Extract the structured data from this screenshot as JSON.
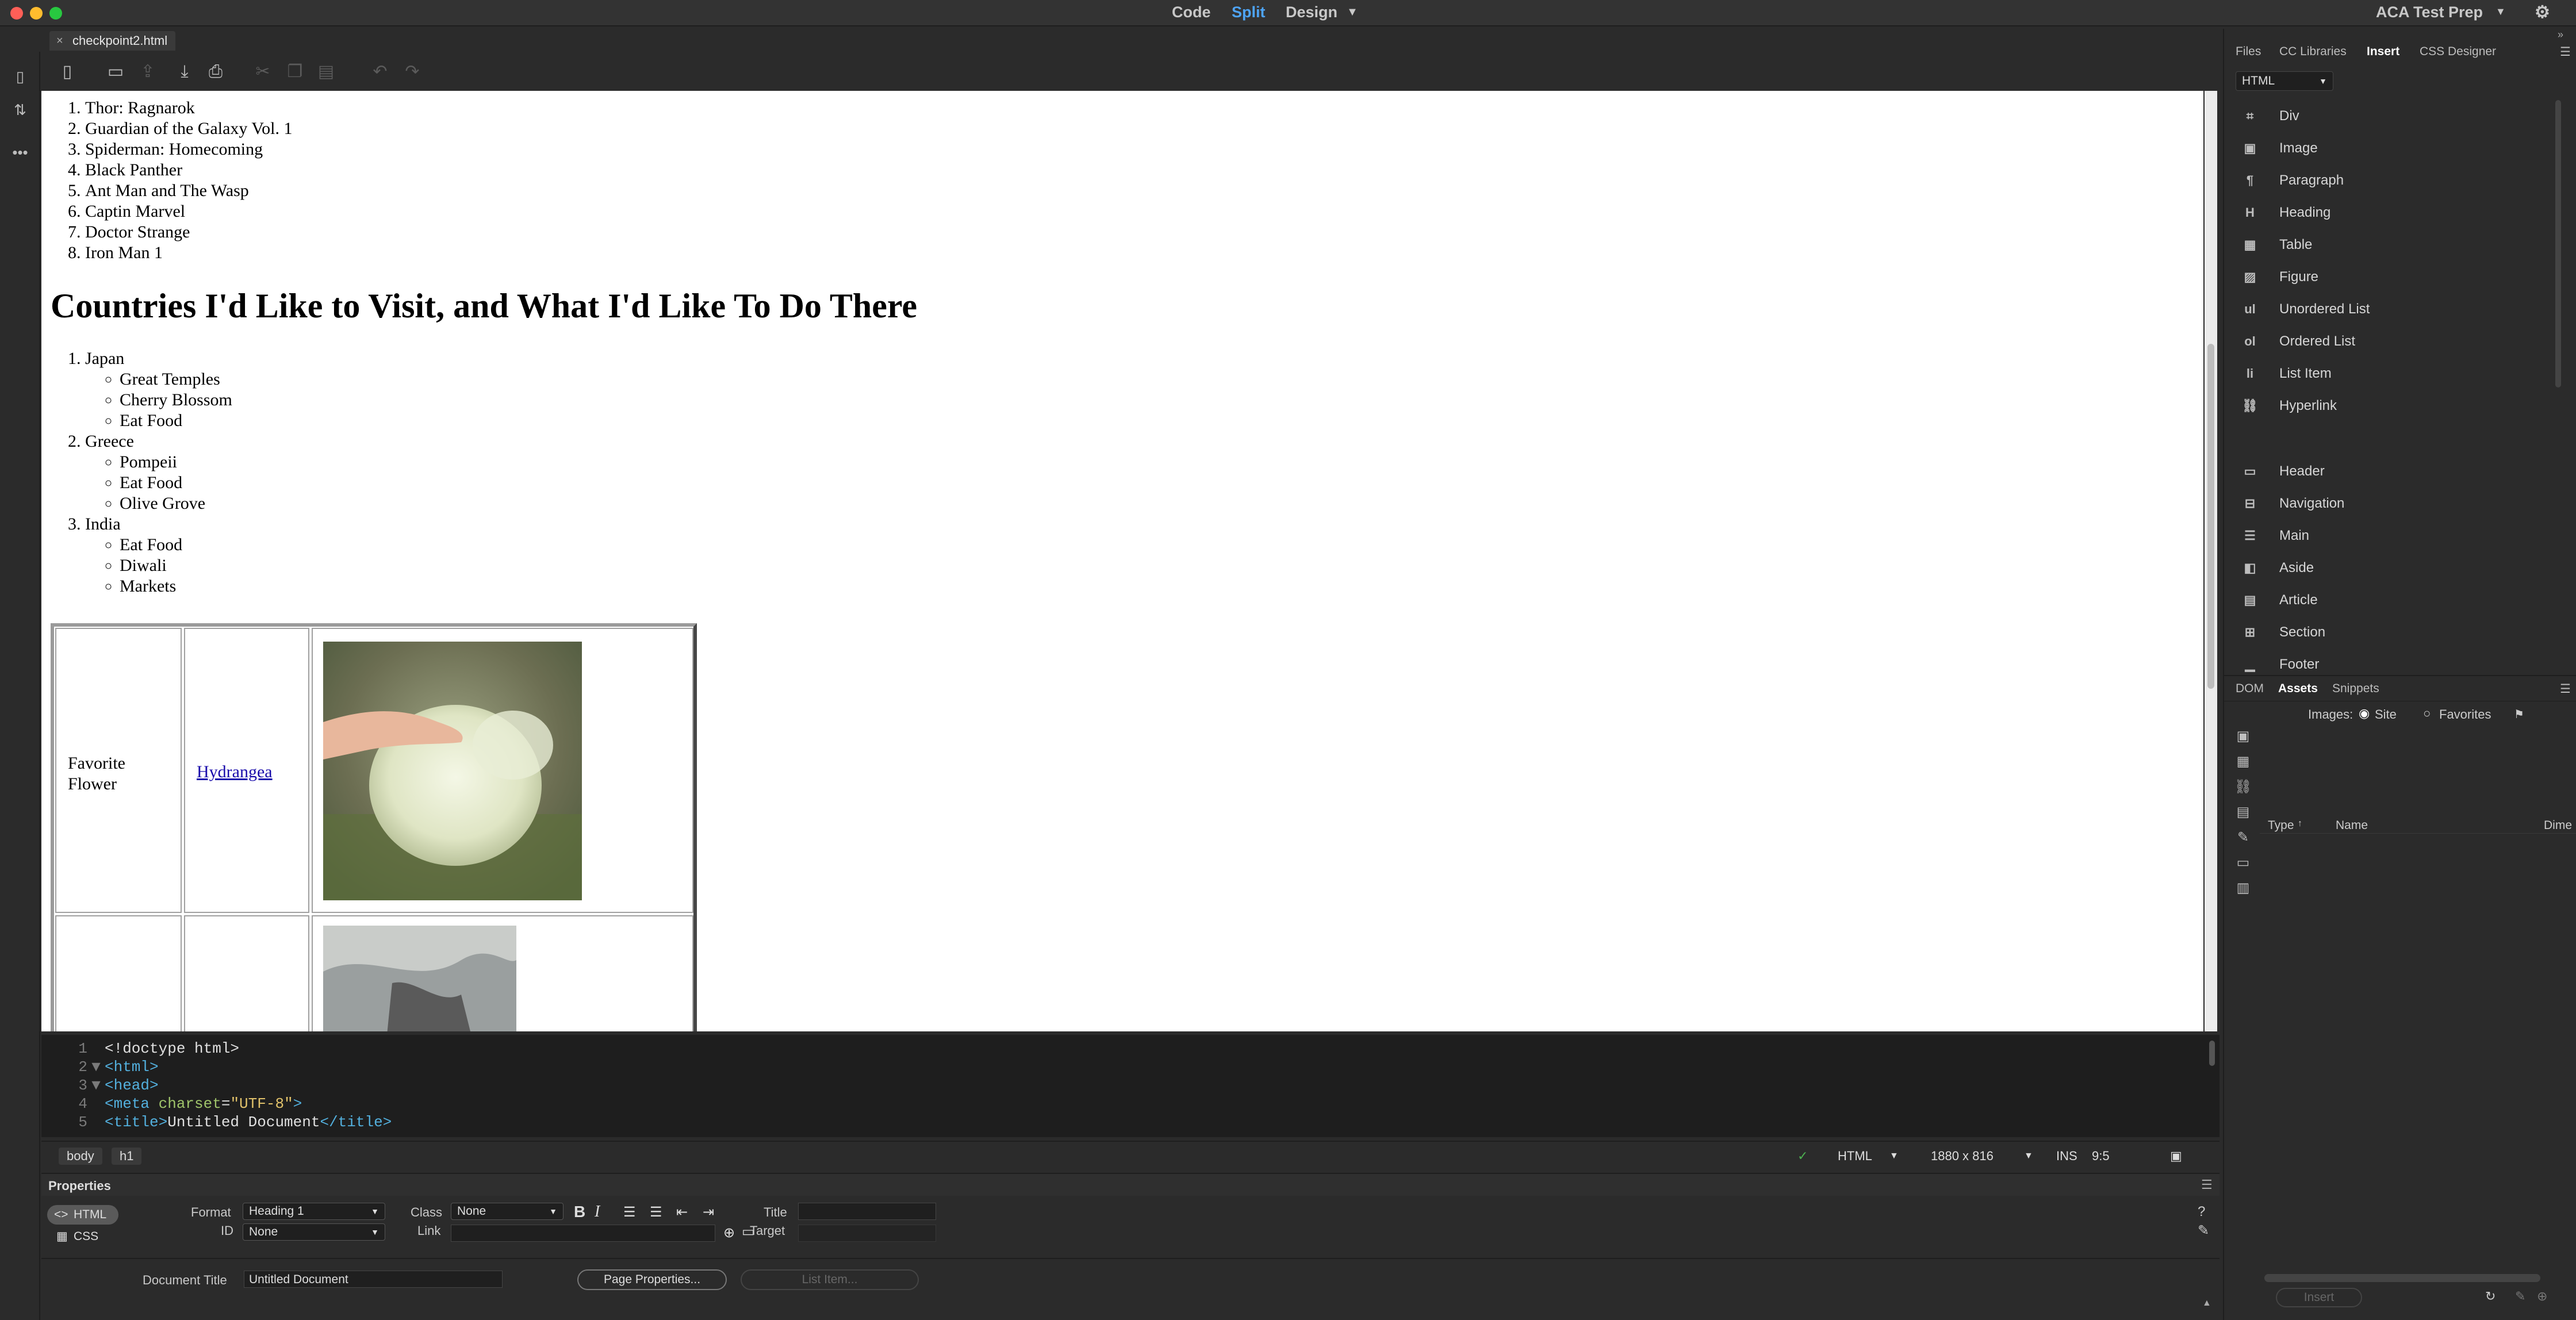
{
  "titlebar": {
    "modes": [
      "Code",
      "Split",
      "Design"
    ],
    "active_mode": "Split",
    "workspace": "ACA Test Prep"
  },
  "document": {
    "tab_label": "checkpoint2.html",
    "close_glyph": "×"
  },
  "design": {
    "movies": [
      "Thor: Ragnarok",
      "Guardian of the Galaxy Vol. 1",
      "Spiderman: Homecoming",
      "Black Panther",
      "Ant Man and The Wasp",
      "Captin Marvel",
      "Doctor Strange",
      "Iron Man 1"
    ],
    "heading": "Countries I'd Like to Visit, and What I'd Like To Do There",
    "countries": [
      {
        "name": "Japan",
        "items": [
          "Great Temples",
          "Cherry Blossom",
          "Eat Food"
        ]
      },
      {
        "name": "Greece",
        "items": [
          "Pompeii",
          "Eat Food",
          "Olive Grove"
        ]
      },
      {
        "name": "India",
        "items": [
          "Eat Food",
          "Diwali",
          "Markets"
        ]
      }
    ],
    "table": {
      "label_line1": "Favorite",
      "label_line2": "Flower",
      "link": "Hydrangea"
    }
  },
  "code": {
    "lines": [
      {
        "num": "1",
        "fold": "",
        "parts": [
          {
            "t": "<!doctype html>",
            "c": "c-txt"
          }
        ]
      },
      {
        "num": "2",
        "fold": "▼",
        "parts": [
          {
            "t": "<html>",
            "c": "c-tag"
          }
        ]
      },
      {
        "num": "3",
        "fold": "▼",
        "parts": [
          {
            "t": "<head>",
            "c": "c-tag"
          }
        ]
      },
      {
        "num": "4",
        "fold": "",
        "parts": [
          {
            "t": "<meta ",
            "c": "c-tag"
          },
          {
            "t": "charset",
            "c": "c-attr"
          },
          {
            "t": "=",
            "c": "c-txt"
          },
          {
            "t": "\"UTF-8\"",
            "c": "c-str"
          },
          {
            "t": ">",
            "c": "c-tag"
          }
        ]
      },
      {
        "num": "5",
        "fold": "",
        "parts": [
          {
            "t": "<title>",
            "c": "c-tag"
          },
          {
            "t": "Untitled Document",
            "c": "c-txt"
          },
          {
            "t": "</title>",
            "c": "c-tag"
          }
        ]
      }
    ]
  },
  "statusbar": {
    "tag_body": "body",
    "tag_h1": "h1",
    "language": "HTML",
    "window_size": "1880 x 816",
    "mode": "INS",
    "position": "9:5"
  },
  "properties": {
    "title": "Properties",
    "html_toggle": "HTML",
    "css_toggle": "CSS",
    "format_label": "Format",
    "format_value": "Heading 1",
    "id_label": "ID",
    "id_value": "None",
    "class_label": "Class",
    "class_value": "None",
    "link_label": "Link",
    "title_label": "Title",
    "target_label": "Target",
    "doc_title_label": "Document Title",
    "doc_title_value": "Untitled Document",
    "page_props_button": "Page Properties...",
    "list_item_button": "List Item..."
  },
  "right_panel": {
    "tabs": [
      "Files",
      "CC Libraries",
      "Insert",
      "CSS Designer"
    ],
    "active_tab": "Insert",
    "category": "HTML",
    "insert_items": [
      {
        "icon": "div-icon",
        "glyph": "⌗",
        "label": "Div"
      },
      {
        "icon": "image-icon",
        "glyph": "▣",
        "label": "Image"
      },
      {
        "icon": "paragraph-icon",
        "glyph": "¶",
        "label": "Paragraph"
      },
      {
        "icon": "heading-icon",
        "glyph": "H",
        "label": "Heading"
      },
      {
        "icon": "table-icon",
        "glyph": "▦",
        "label": "Table"
      },
      {
        "icon": "figure-icon",
        "glyph": "▨",
        "label": "Figure"
      },
      {
        "icon": "unordered-list-icon",
        "glyph": "ul",
        "label": "Unordered List"
      },
      {
        "icon": "ordered-list-icon",
        "glyph": "ol",
        "label": "Ordered List"
      },
      {
        "icon": "list-item-icon",
        "glyph": "li",
        "label": "List Item"
      },
      {
        "icon": "hyperlink-icon",
        "glyph": "⛓",
        "label": "Hyperlink"
      }
    ],
    "structure_items": [
      {
        "icon": "header-icon",
        "glyph": "▭",
        "label": "Header"
      },
      {
        "icon": "navigation-icon",
        "glyph": "⊟",
        "label": "Navigation"
      },
      {
        "icon": "main-icon",
        "glyph": "☰",
        "label": "Main"
      },
      {
        "icon": "aside-icon",
        "glyph": "◧",
        "label": "Aside"
      },
      {
        "icon": "article-icon",
        "glyph": "▤",
        "label": "Article"
      },
      {
        "icon": "section-icon",
        "glyph": "⊞",
        "label": "Section"
      },
      {
        "icon": "footer-icon",
        "glyph": "▁",
        "label": "Footer"
      }
    ],
    "lower_tabs": [
      "DOM",
      "Assets",
      "Snippets"
    ],
    "active_lower_tab": "Assets",
    "images_label": "Images:",
    "site_label": "Site",
    "favorites_label": "Favorites",
    "col_type": "Type",
    "col_name": "Name",
    "col_dim": "Dime",
    "insert_button": "Insert"
  }
}
